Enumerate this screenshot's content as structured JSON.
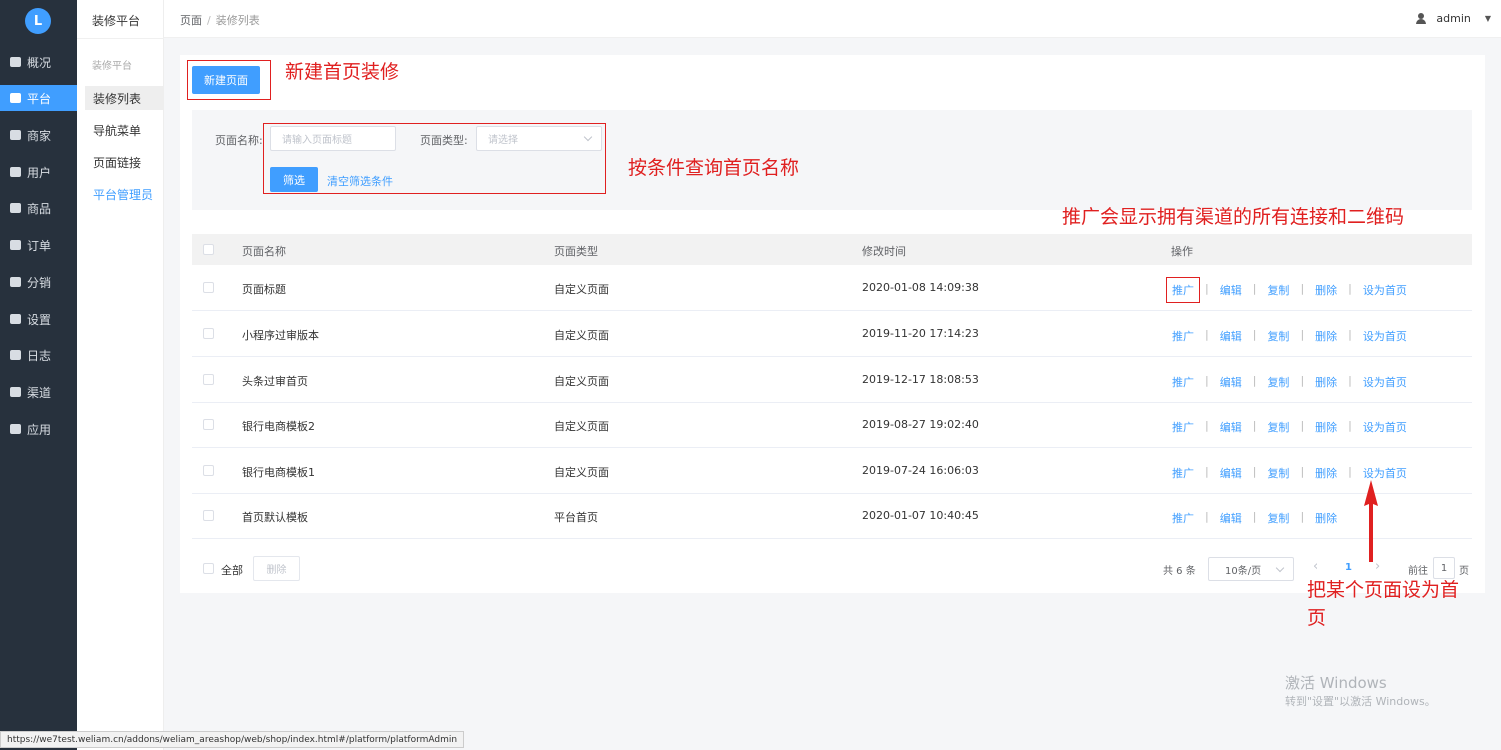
{
  "nav": {
    "logo": "L",
    "items": [
      {
        "label": "概况",
        "icon": "monitor-icon"
      },
      {
        "label": "平台",
        "icon": "screen-icon",
        "active": true
      },
      {
        "label": "商家",
        "icon": "shop-icon"
      },
      {
        "label": "用户",
        "icon": "user-icon"
      },
      {
        "label": "商品",
        "icon": "goods-icon"
      },
      {
        "label": "订单",
        "icon": "order-icon"
      },
      {
        "label": "分销",
        "icon": "distribution-icon"
      },
      {
        "label": "设置",
        "icon": "gear-icon"
      },
      {
        "label": "日志",
        "icon": "log-icon"
      },
      {
        "label": "渠道",
        "icon": "channel-icon"
      },
      {
        "label": "应用",
        "icon": "apps-icon"
      }
    ]
  },
  "subnav": {
    "title": "装修平台",
    "group": "装修平台",
    "links": [
      {
        "label": "装修列表",
        "active": true
      },
      {
        "label": "导航菜单"
      },
      {
        "label": "页面链接"
      },
      {
        "label": "平台管理员",
        "blue": true
      }
    ]
  },
  "header": {
    "crumb_root": "页面",
    "crumb_sep": "/",
    "crumb_current": "装修列表",
    "user": "admin"
  },
  "toolbar": {
    "new_page": "新建页面"
  },
  "filter": {
    "name_label": "页面名称:",
    "name_placeholder": "请输入页面标题",
    "type_label": "页面类型:",
    "type_placeholder": "请选择",
    "search_button": "筛选",
    "clear_link": "清空筛选条件"
  },
  "table": {
    "columns": [
      "页面名称",
      "页面类型",
      "修改时间",
      "操作"
    ],
    "rows": [
      {
        "name": "页面标题",
        "type": "自定义页面",
        "time": "2020-01-08 14:09:38",
        "ops": [
          "推广",
          "编辑",
          "复制",
          "删除",
          "设为首页"
        ]
      },
      {
        "name": "小程序过审版本",
        "type": "自定义页面",
        "time": "2019-11-20 17:14:23",
        "ops": [
          "推广",
          "编辑",
          "复制",
          "删除",
          "设为首页"
        ]
      },
      {
        "name": "头条过审首页",
        "type": "自定义页面",
        "time": "2019-12-17 18:08:53",
        "ops": [
          "推广",
          "编辑",
          "复制",
          "删除",
          "设为首页"
        ]
      },
      {
        "name": "银行电商模板2",
        "type": "自定义页面",
        "time": "2019-08-27 19:02:40",
        "ops": [
          "推广",
          "编辑",
          "复制",
          "删除",
          "设为首页"
        ]
      },
      {
        "name": "银行电商模板1",
        "type": "自定义页面",
        "time": "2019-07-24 16:06:03",
        "ops": [
          "推广",
          "编辑",
          "复制",
          "删除",
          "设为首页"
        ]
      },
      {
        "name": "首页默认模板",
        "type": "平台首页",
        "time": "2020-01-07 10:40:45",
        "ops": [
          "推广",
          "编辑",
          "复制",
          "删除"
        ]
      }
    ]
  },
  "footer": {
    "select_all": "全部",
    "delete": "删除",
    "total": "共 6 条",
    "page_size": "10条/页",
    "prev": "‹",
    "current_page": "1",
    "next": "›",
    "goto_label": "前往",
    "goto_value": "1",
    "goto_unit": "页"
  },
  "annotations": {
    "new_home": "新建首页装修",
    "query": "按条件查询首页名称",
    "promote": "推广会显示拥有渠道的所有连接和二维码",
    "set_home_line1": "把某个页面设为首",
    "set_home_line2": "页"
  },
  "watermark": {
    "line1": "激活 Windows",
    "line2": "转到\"设置\"以激活 Windows。"
  },
  "statusbar": "https://we7test.weliam.cn/addons/weliam_areashop/web/shop/index.html#/platform/platformAdmin",
  "colors": {
    "primary": "#409eff",
    "annotation": "#e02020",
    "nav_bg": "#27313d"
  }
}
